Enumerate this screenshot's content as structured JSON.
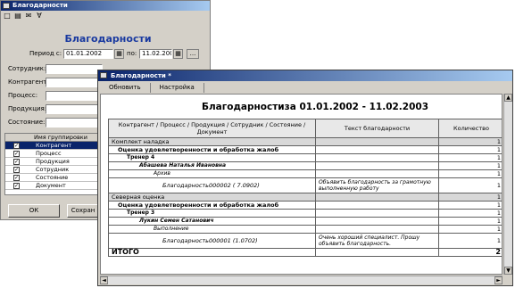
{
  "back_window": {
    "title": "Благодарности",
    "toolbar": [
      "□",
      "▤",
      "✉",
      "∀"
    ],
    "heading": "Благодарности",
    "period_label": "Период с:",
    "date_from": "01.01.2002",
    "to_label": "по:",
    "date_to": "11.02.2003",
    "calendar_glyph": "▦",
    "ellipsis": "...",
    "fields": [
      {
        "label": "Сотрудник:",
        "value": ""
      },
      {
        "label": "Контрагент:",
        "value": ""
      },
      {
        "label": "Процесс:",
        "value": ""
      },
      {
        "label": "Продукция:",
        "value": ""
      },
      {
        "label": "Состояние:",
        "value": ""
      }
    ],
    "grid_header": "Имя группировки",
    "grid_rows": [
      "Контрагент",
      "Процесс",
      "Продукция",
      "Сотрудник",
      "Состояние",
      "Документ"
    ],
    "ok_label": "ОК",
    "second_button_label": "Сохран"
  },
  "front_window": {
    "title": "Благодарности",
    "title_marker": "*",
    "toolbar": {
      "refresh": "Обновить",
      "settings": "Настройка"
    },
    "report_title": "Благодарностиза 01.01.2002 - 11.02.2003",
    "columns": [
      "Контрагент / Процесс / Продукция / Сотрудник / Состояние / Документ",
      "Текст благодарности",
      "Количество"
    ],
    "rows": [
      {
        "level": 1,
        "name": "Комплект наладка",
        "text": "",
        "qty": "1"
      },
      {
        "level": 2,
        "name": "Оценка удовлетворенности и обработка жалоб",
        "text": "",
        "qty": "1"
      },
      {
        "level": 3,
        "name": "Тренер 4",
        "text": "",
        "qty": "1"
      },
      {
        "level": 4,
        "name": "Абашева Наталья Ивановна",
        "text": "",
        "qty": "1"
      },
      {
        "level": 5,
        "name": "Архив",
        "text": "",
        "qty": "1"
      },
      {
        "level": 6,
        "name": "Благодарность000002 ( 7.0902)",
        "text": "Объявить благодарность за грамотную выполненную работу",
        "qty": "1"
      },
      {
        "level": 1,
        "name": "Северная оценка",
        "text": "",
        "qty": "1"
      },
      {
        "level": 2,
        "name": "Оценка удовлетворенности и обработка жалоб",
        "text": "",
        "qty": "1"
      },
      {
        "level": 3,
        "name": "Тренер 3",
        "text": "",
        "qty": "1"
      },
      {
        "level": 4,
        "name": "Лукин Семен Сатанович",
        "text": "",
        "qty": "1"
      },
      {
        "level": 5,
        "name": "Выполнение",
        "text": "",
        "qty": "1"
      },
      {
        "level": 6,
        "name": "Благодарность000001 (1.0702)",
        "text": "Очень хороший специалист. Прошу объявить благодарность.",
        "qty": "1"
      }
    ],
    "total_label": "ИТОГО",
    "total_qty": "2",
    "scroll_arrows": {
      "up": "▲",
      "down": "▼",
      "left": "◄",
      "right": "►"
    }
  }
}
